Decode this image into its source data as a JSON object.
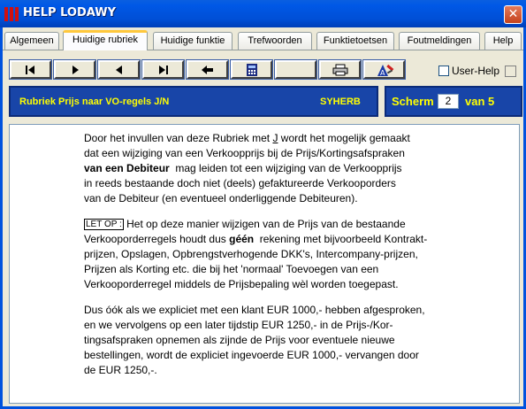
{
  "window": {
    "title": "HELP LODAWY",
    "close_glyph": "✕"
  },
  "tabs": [
    {
      "label": "Algemeen"
    },
    {
      "label": "Huidige rubriek",
      "active": true
    },
    {
      "label": "Huidige funktie"
    },
    {
      "label": "Trefwoorden"
    },
    {
      "label": "Funktietoetsen"
    },
    {
      "label": "Foutmeldingen"
    },
    {
      "label": "Help"
    }
  ],
  "toolbar": {
    "buttons": [
      {
        "icon": "first-page-icon"
      },
      {
        "icon": "play-forward-icon"
      },
      {
        "icon": "back-arrow-icon"
      },
      {
        "icon": "last-page-icon"
      },
      {
        "icon": "return-left-icon"
      },
      {
        "icon": "calculator-icon"
      },
      {
        "icon": "blank-icon"
      },
      {
        "icon": "printer-icon"
      },
      {
        "icon": "tools-icon"
      }
    ],
    "userhelp_label": "User-Help",
    "userhelp_checked": false
  },
  "rubriek": {
    "title": "Rubriek Prijs naar VO-regels J/N",
    "code": "SYHERB"
  },
  "scherm": {
    "label": "Scherm",
    "current": "2",
    "of_label": "van 5"
  },
  "content": {
    "p1": {
      "l1_pre": "Door het invullen van deze Rubriek met ",
      "l1_j": "J",
      "l1_post": " wordt het mogelijk gemaakt",
      "l2": "dat een wijziging van een Verkoopprijs bij de Prijs/Kortingsafspraken",
      "l3_bold": "van een Debiteur",
      "l3_post": "  mag leiden tot een wijziging van de Verkoopprijs",
      "l4": "in reeds bestaande doch niet (deels) gefaktureerde Verkooporders",
      "l5": "van de Debiteur (en eventueel onderliggende Debiteuren)."
    },
    "p2": {
      "letop": "LET OP :",
      "l1_post": " Het op deze manier wijzigen van de Prijs van de bestaande",
      "l2_pre": "Verkooporderregels houdt dus ",
      "l2_bold": "géén",
      "l2_post": "  rekening met bijvoorbeeld Kontrakt-",
      "l3": "prijzen, Opslagen, Opbrengstverhogende DKK's, Intercompany-prijzen,",
      "l4": "Prijzen als Korting etc. die bij het 'normaal' Toevoegen van een",
      "l5": "Verkooporderregel middels de Prijsbepaling wèl worden toegepast."
    },
    "p3": {
      "l1": "Dus óók als we expliciet met een klant EUR 1000,- hebben afgesproken,",
      "l2": "en we vervolgens op een later tijdstip EUR 1250,- in de Prijs-/Kor-",
      "l3": "tingsafspraken opnemen als zijnde de Prijs voor eventuele nieuwe",
      "l4": "bestellingen, wordt de expliciet ingevoerde EUR 1000,- vervangen door",
      "l5": "de EUR 1250,-."
    }
  }
}
